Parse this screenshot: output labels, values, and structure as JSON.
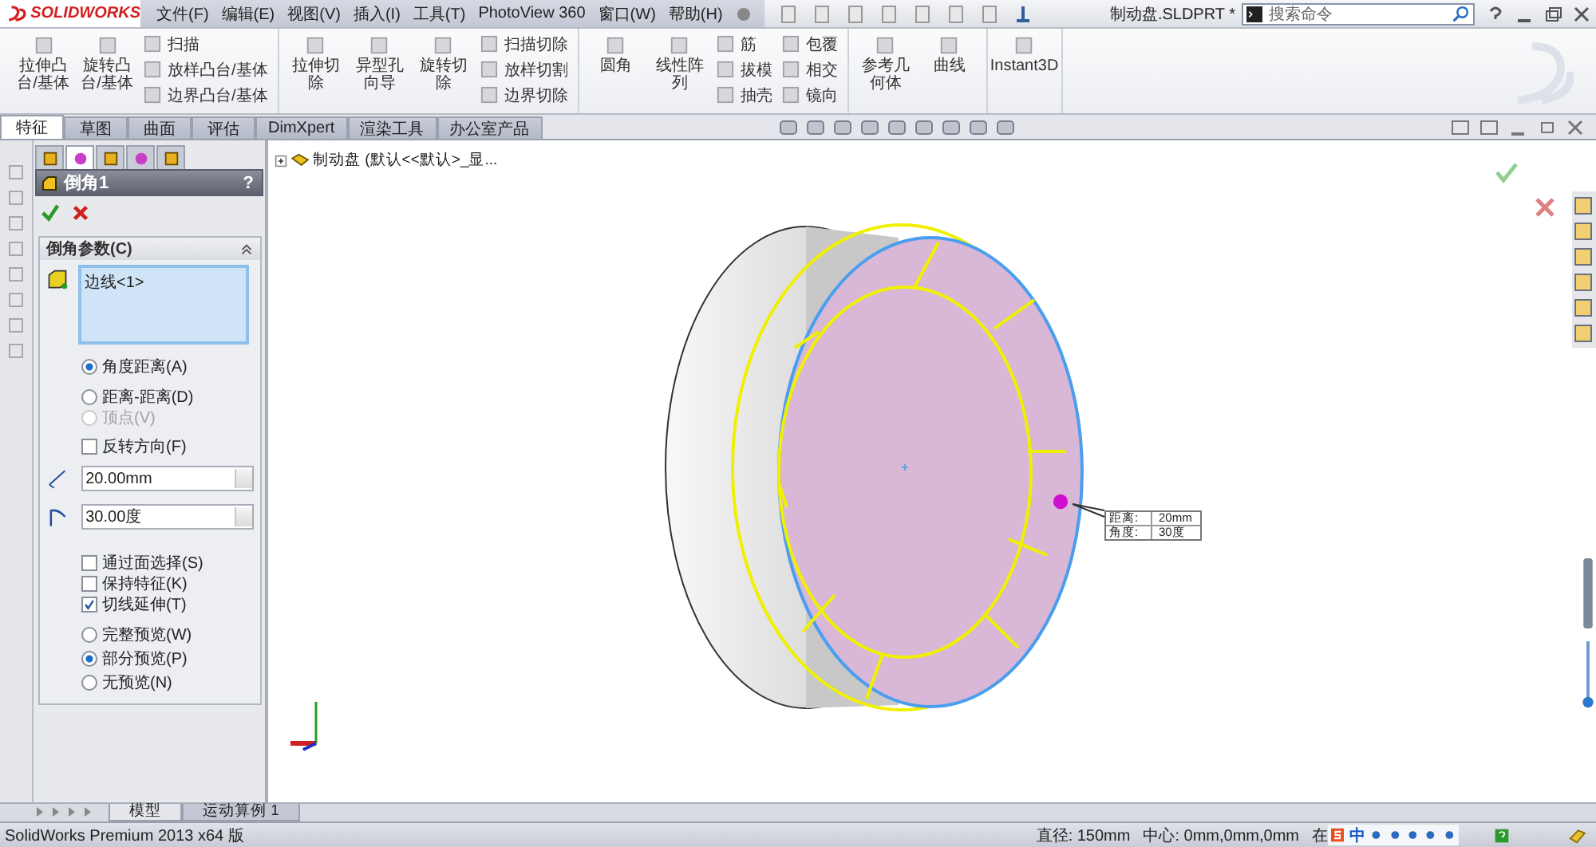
{
  "app": {
    "logo": "SOLIDWORKS"
  },
  "menu": [
    "文件(F)",
    "编辑(E)",
    "视图(V)",
    "插入(I)",
    "工具(T)",
    "PhotoView 360",
    "窗口(W)",
    "帮助(H)"
  ],
  "document_title": "制动盘.SLDPRT *",
  "search": {
    "placeholder": "搜索命令"
  },
  "ribbon": [
    {
      "items": [
        {
          "kind": "large",
          "label": "拉伸凸台/基体"
        },
        {
          "kind": "large",
          "label": "旋转凸台/基体"
        },
        {
          "kind": "small",
          "label": "扫描"
        },
        {
          "kind": "small",
          "label": "放样凸台/基体"
        },
        {
          "kind": "small",
          "label": "边界凸台/基体"
        }
      ]
    },
    {
      "items": [
        {
          "kind": "large",
          "label": "拉伸切除"
        },
        {
          "kind": "large",
          "label": "异型孔向导"
        },
        {
          "kind": "large",
          "label": "旋转切除"
        },
        {
          "kind": "small",
          "label": "扫描切除"
        },
        {
          "kind": "small",
          "label": "放样切割"
        },
        {
          "kind": "small",
          "label": "边界切除"
        }
      ]
    },
    {
      "items": [
        {
          "kind": "large",
          "label": "圆角"
        },
        {
          "kind": "large",
          "label": "线性阵列"
        },
        {
          "kind": "small",
          "label": "筋"
        },
        {
          "kind": "small",
          "label": "拔模"
        },
        {
          "kind": "small",
          "label": "抽壳"
        },
        {
          "kind": "small",
          "label": "包覆"
        },
        {
          "kind": "small",
          "label": "相交"
        },
        {
          "kind": "small",
          "label": "镜向"
        }
      ]
    },
    {
      "items": [
        {
          "kind": "large",
          "label": "参考几何体"
        },
        {
          "kind": "large",
          "label": "曲线"
        }
      ]
    },
    {
      "items": [
        {
          "kind": "large",
          "label": "Instant3D"
        }
      ]
    }
  ],
  "tabs": [
    {
      "label": "特征",
      "selected": true
    },
    {
      "label": "草图",
      "selected": false
    },
    {
      "label": "曲面",
      "selected": false
    },
    {
      "label": "评估",
      "selected": false
    },
    {
      "label": "DimXpert",
      "selected": false
    },
    {
      "label": "渲染工具",
      "selected": false
    },
    {
      "label": "办公室产品",
      "selected": false
    }
  ],
  "panel_tabs": [
    {
      "selected": false
    },
    {
      "selected": true
    },
    {
      "selected": false
    },
    {
      "selected": false
    },
    {
      "selected": false
    }
  ],
  "property_manager": {
    "title": "倒角1",
    "help": "?",
    "section": "倒角参数(C)",
    "selection": "边线<1>",
    "mode_options": [
      {
        "label": "角度距离(A)",
        "selected": true,
        "disabled": false
      },
      {
        "label": "距离-距离(D)",
        "selected": false,
        "disabled": false
      },
      {
        "label": "顶点(V)",
        "selected": false,
        "disabled": true
      }
    ],
    "reverse_direction": {
      "label": "反转方向(F)",
      "checked": false
    },
    "distance": {
      "value": "20.00mm"
    },
    "angle": {
      "value": "30.00度"
    },
    "extra_options": [
      {
        "kind": "checkbox",
        "label": "通过面选择(S)",
        "checked": false
      },
      {
        "kind": "checkbox",
        "label": "保持特征(K)",
        "checked": false
      },
      {
        "kind": "checkbox",
        "label": "切线延伸(T)",
        "checked": true
      },
      {
        "kind": "radio",
        "label": "完整预览(W)",
        "checked": false
      },
      {
        "kind": "radio",
        "label": "部分预览(P)",
        "checked": true
      },
      {
        "kind": "radio",
        "label": "无预览(N)",
        "checked": false
      }
    ]
  },
  "feature_tree": {
    "root": "制动盘  (默认<<默认>_显..."
  },
  "callout": [
    {
      "label": "距离:",
      "value": "20mm"
    },
    {
      "label": "角度:",
      "value": "30度"
    }
  ],
  "bottom_tabs": [
    {
      "label": "模型",
      "selected": true
    },
    {
      "label": "运动算例 1",
      "selected": false
    }
  ],
  "status_bar": {
    "product": "SolidWorks Premium 2013 x64 版",
    "diameter": "直径: 150mm",
    "center": "中心: 0mm,0mm,0mm",
    "mode": "在",
    "ime": "中"
  }
}
